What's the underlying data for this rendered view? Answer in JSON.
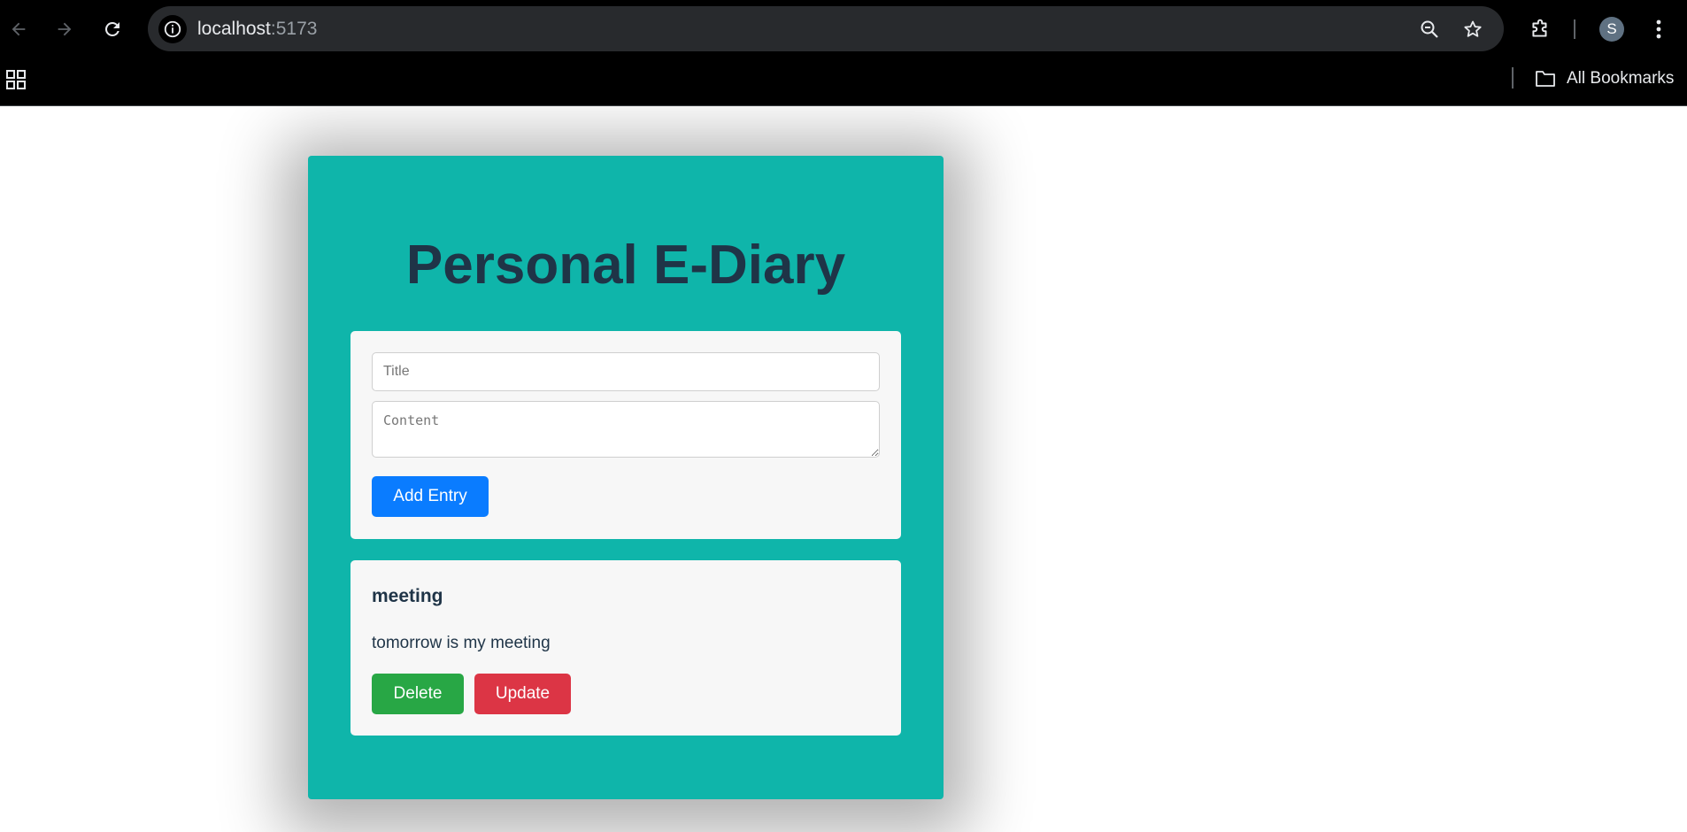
{
  "browser": {
    "url_host": "localhost",
    "url_port": ":5173",
    "profile_initial": "S",
    "bookmarks_label": "All Bookmarks",
    "icons": {
      "back": "back-arrow-icon",
      "forward": "forward-arrow-icon",
      "reload": "reload-icon",
      "site_info": "info-icon",
      "zoom": "zoom-out-icon",
      "bookmark": "star-icon",
      "extensions": "puzzle-icon",
      "menu": "kebab-menu-icon",
      "apps": "apps-grid-icon",
      "folder": "folder-icon"
    }
  },
  "app": {
    "title": "Personal E-Diary",
    "form": {
      "title_placeholder": "Title",
      "content_placeholder": "Content",
      "title_value": "",
      "content_value": "",
      "add_label": "Add Entry"
    },
    "entries": [
      {
        "title": "meeting",
        "content": "tomorrow is my meeting",
        "delete_label": "Delete",
        "update_label": "Update"
      }
    ]
  },
  "colors": {
    "card_bg": "#0fb5aa",
    "title_text": "#1f3447",
    "add_button": "#0a7cff",
    "delete_button": "#28a745",
    "update_button": "#dc3545"
  }
}
